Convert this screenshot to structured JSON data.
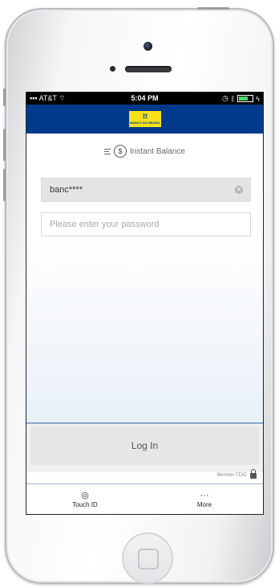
{
  "status_bar": {
    "carrier": "AT&T",
    "time": "5:04 PM"
  },
  "header": {
    "logo_text": "BANCO DO BRASIL"
  },
  "instant_balance": {
    "label": "Instant Balance",
    "icon": "dollar-coin-icon"
  },
  "login_form": {
    "username_value": "banc****",
    "password_placeholder": "Please enter your password",
    "login_label": "Log In"
  },
  "footer": {
    "member_fdic": "Member FDIC"
  },
  "tab_bar": {
    "items": [
      {
        "label": "Touch ID",
        "icon": "fingerprint-icon"
      },
      {
        "label": "More",
        "icon": "more-dots-icon"
      }
    ]
  },
  "colors": {
    "brand_blue": "#003a8c",
    "brand_yellow": "#f7e11b"
  }
}
